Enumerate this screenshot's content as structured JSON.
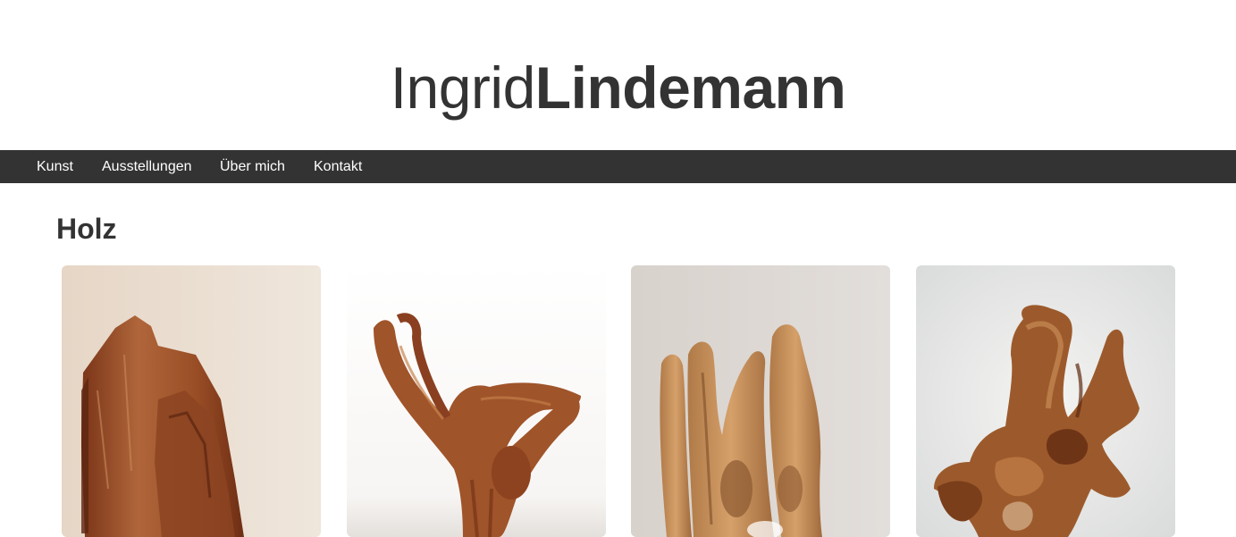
{
  "header": {
    "logo_first": "Ingrid",
    "logo_last": "Lindemann"
  },
  "nav": {
    "items": [
      {
        "label": "Kunst"
      },
      {
        "label": "Ausstellungen"
      },
      {
        "label": "Über mich"
      },
      {
        "label": "Kontakt"
      }
    ]
  },
  "main": {
    "title": "Holz",
    "gallery": [
      {
        "icon": "wood-sculpture-photo-1"
      },
      {
        "icon": "wood-sculpture-photo-2"
      },
      {
        "icon": "wood-sculpture-photo-3"
      },
      {
        "icon": "wood-sculpture-photo-4"
      }
    ]
  },
  "colors": {
    "text": "#333333",
    "navbar_bg": "#333333",
    "nav_text": "#ffffff",
    "background": "#ffffff",
    "wood": "#a0522d"
  }
}
